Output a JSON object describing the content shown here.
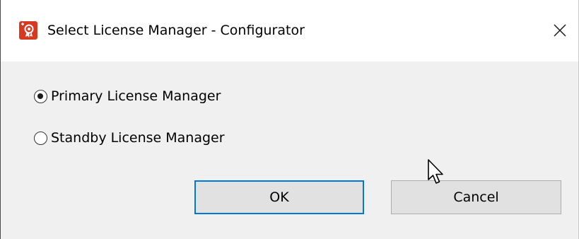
{
  "window": {
    "title": "Select License Manager - Configurator",
    "icon": "license-manager-app-icon",
    "close_icon": "close-icon"
  },
  "options": [
    {
      "label": "Primary License Manager",
      "selected": true
    },
    {
      "label": "Standby License Manager",
      "selected": false
    }
  ],
  "buttons": {
    "ok_label": "OK",
    "cancel_label": "Cancel"
  },
  "colors": {
    "app_icon": "#d8381f",
    "focus_border": "#0078d7",
    "dialog_background": "#f0f0f0",
    "button_background": "#e1e1e1"
  }
}
